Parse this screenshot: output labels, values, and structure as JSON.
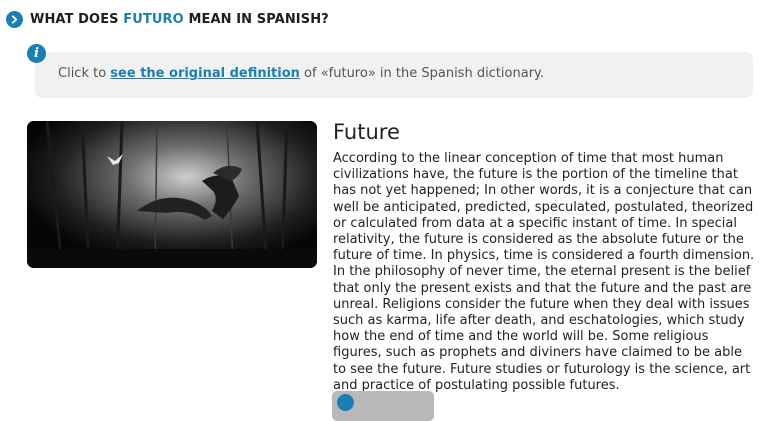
{
  "section": {
    "title_prefix": "What does ",
    "title_word": "futuro",
    "title_suffix": " mean in Spanish?"
  },
  "info": {
    "prefix": "Click to ",
    "link_text": "see the original definition",
    "suffix": " of «futuro» in the Spanish dictionary."
  },
  "article": {
    "heading": "Future",
    "body": "According to the linear conception of time that most human civilizations have, the future is the portion of the timeline that has not yet happened; In other words, it is a conjecture that can well be anticipated, predicted, speculated, postulated, theorized or calculated from data at a specific instant of time. In special relativity, the future is considered as the absolute future or the future of time. In physics, time is considered a fourth dimension. In the philosophy of never time, the eternal present is the belief that only the present exists and that the future and the past are unreal. Religions consider the future when they deal with issues such as karma, life after death, and eschatologies, which study how the end of time and the world will be. Some religious figures, such as prophets and diviners have claimed to be able to see the future. Future studies or futurology is the science, art and practice of postulating possible futures."
  },
  "colors": {
    "accent": "#1a7fb5",
    "info_bg": "#f1f1f1"
  },
  "icons": [
    "chevron-right-icon",
    "info-icon"
  ]
}
